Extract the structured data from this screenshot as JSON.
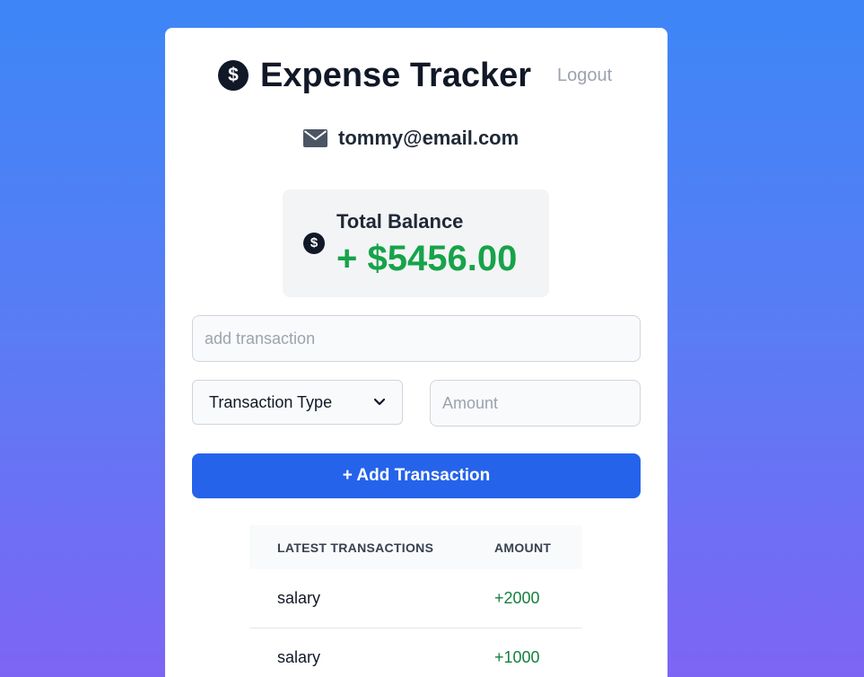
{
  "header": {
    "logo_icon": "dollar-circle-icon",
    "logo_glyph": "$",
    "title": "Expense Tracker",
    "logout_label": "Logout"
  },
  "user": {
    "email_icon": "envelope-icon",
    "email": "tommy@email.com"
  },
  "balance": {
    "icon": "dollar-circle-icon",
    "icon_glyph": "$",
    "label": "Total Balance",
    "value": "+ $5456.00",
    "value_color": "#16a34a"
  },
  "form": {
    "transaction_placeholder": "add transaction",
    "transaction_value": "",
    "type_selected": "Transaction Type",
    "amount_placeholder": "Amount",
    "amount_value": "",
    "add_button_label": "+ Add Transaction"
  },
  "transactions": {
    "headers": [
      "LATEST TRANSACTIONS",
      "AMOUNT"
    ],
    "rows": [
      {
        "name": "salary",
        "amount": "+2000"
      },
      {
        "name": "salary",
        "amount": "+1000"
      }
    ]
  },
  "colors": {
    "accent": "#2563eb",
    "positive": "#16a34a",
    "background_top": "#3d86f7",
    "background_bottom": "#7d65f3"
  }
}
